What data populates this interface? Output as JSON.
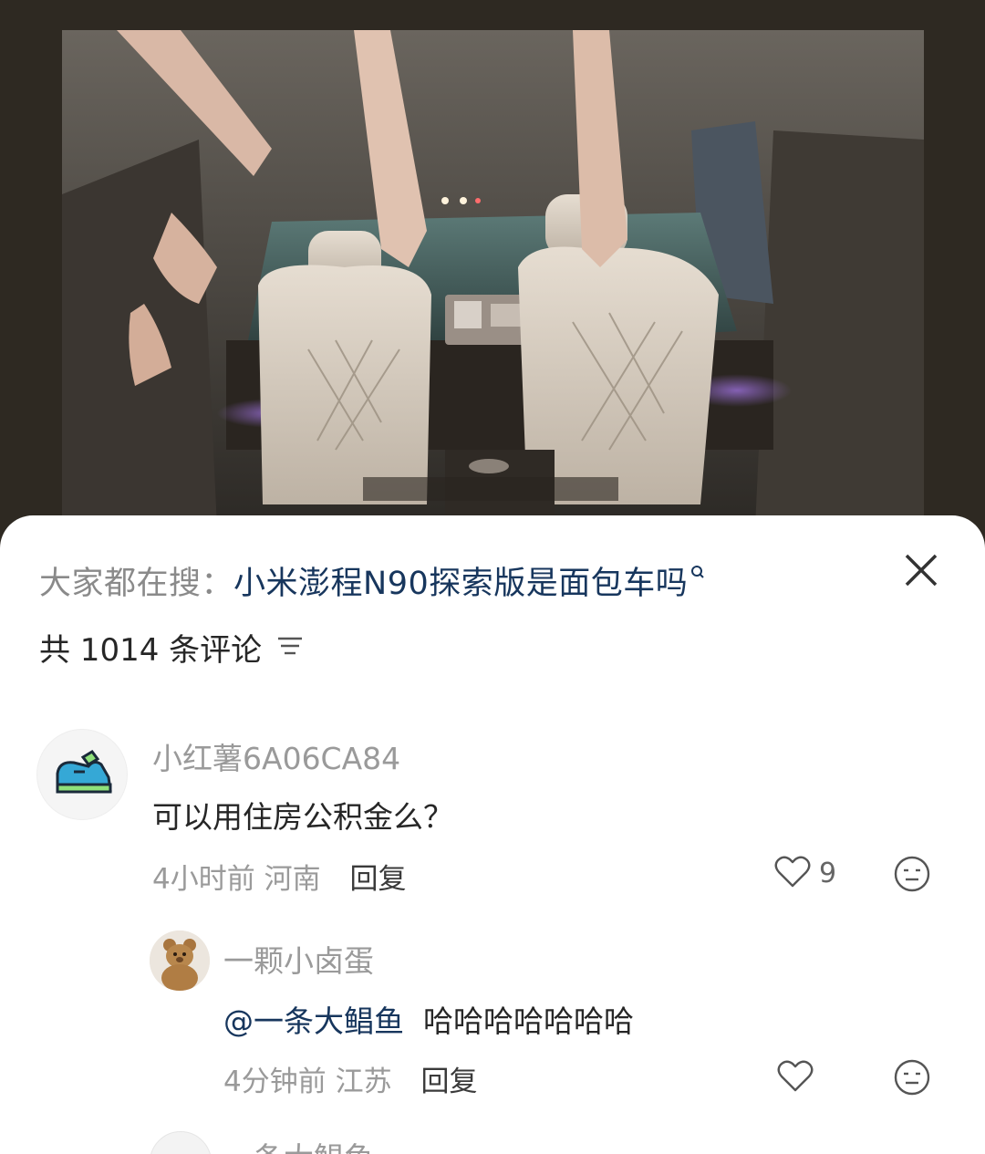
{
  "search_hint": {
    "prefix": "大家都在搜：",
    "query": "小米澎程N90探索版是面包车吗"
  },
  "comments_header": {
    "count_text": "共 1014 条评论"
  },
  "comments": [
    {
      "username": "小红薯6A06CA84",
      "content": "可以用住房公积金么？",
      "time": "4小时前",
      "location": "河南",
      "reply_label": "回复",
      "likes": "9"
    }
  ],
  "replies": [
    {
      "username": "一颗小卤蛋",
      "mention": "@一条大鲳鱼",
      "content": "哈哈哈哈哈哈哈",
      "time": "4分钟前",
      "location": "江苏",
      "reply_label": "回复"
    },
    {
      "username": "一条大鲳鱼"
    }
  ],
  "icons": {
    "close": "close-icon",
    "sort": "sort-icon",
    "search_small": "search-icon",
    "like": "heart-icon",
    "react": "emoji-icon"
  },
  "colors": {
    "link": "#17365d",
    "muted": "#9a9a9a",
    "text": "#262626"
  }
}
